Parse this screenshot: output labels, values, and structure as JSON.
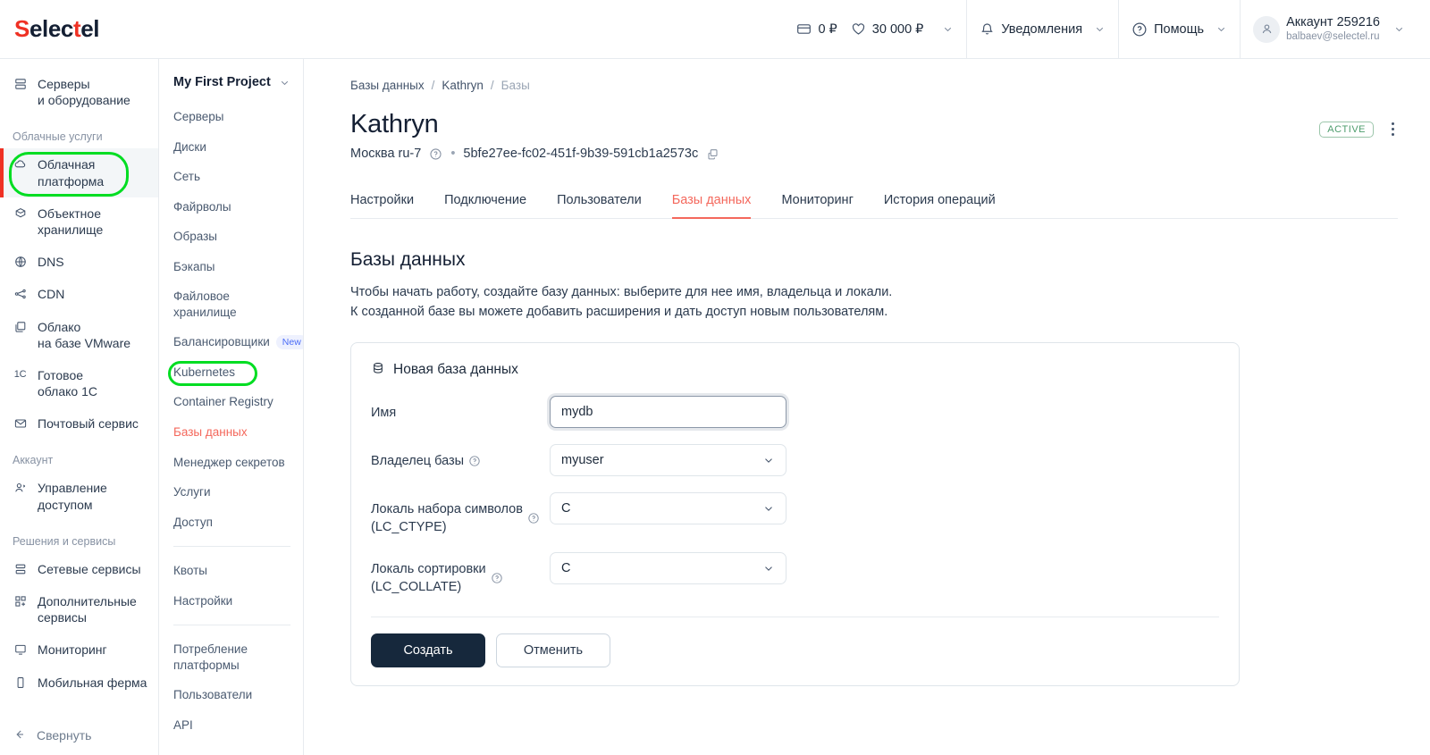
{
  "brand": {
    "name_prefix": "S",
    "name_mid": "elec",
    "name_t": "t",
    "name_suffix": "el"
  },
  "header": {
    "balance": "0 ₽",
    "bonus": "30 000 ₽",
    "notifications": "Уведомления",
    "help": "Помощь",
    "account_name": "Аккаунт 259216",
    "account_email": "balbaev@selectel.ru"
  },
  "leftnav": {
    "items": [
      {
        "label": "Серверы\nи оборудование",
        "icon": "servers-icon",
        "type": "item",
        "active": false
      },
      {
        "label": "Облачные услуги",
        "type": "section"
      },
      {
        "label": "Облачная\nплатформа",
        "icon": "cloud-icon",
        "type": "item",
        "active": true
      },
      {
        "label": "Объектное\nхранилище",
        "icon": "box-icon",
        "type": "item",
        "active": false
      },
      {
        "label": "DNS",
        "icon": "globe-icon",
        "type": "item",
        "active": false
      },
      {
        "label": "CDN",
        "icon": "cdn-icon",
        "type": "item",
        "active": false
      },
      {
        "label": "Облако\nна базе VMware",
        "icon": "vmware-icon",
        "type": "item",
        "active": false
      },
      {
        "label": "Готовое\nоблако 1С",
        "icon": "1c-icon",
        "type": "item",
        "active": false
      },
      {
        "label": "Почтовый сервис",
        "icon": "mail-icon",
        "type": "item",
        "active": false
      },
      {
        "label": "Аккаунт",
        "type": "section"
      },
      {
        "label": "Управление\nдоступом",
        "icon": "users-icon",
        "type": "item",
        "active": false
      },
      {
        "label": "Решения и сервисы",
        "type": "section"
      },
      {
        "label": "Сетевые сервисы",
        "icon": "network-icon",
        "type": "item",
        "active": false
      },
      {
        "label": "Дополнительные\nсервисы",
        "icon": "apps-icon",
        "type": "item",
        "active": false
      },
      {
        "label": "Мониторинг",
        "icon": "monitor-icon",
        "type": "item",
        "active": false
      },
      {
        "label": "Мобильная ферма",
        "icon": "mobile-icon",
        "type": "item",
        "active": false
      }
    ],
    "collapse_label": "Свернуть"
  },
  "projnav": {
    "project": "My First Project",
    "groups": [
      [
        {
          "label": "Серверы"
        },
        {
          "label": "Диски"
        },
        {
          "label": "Сеть"
        },
        {
          "label": "Файрволы"
        },
        {
          "label": "Образы"
        },
        {
          "label": "Бэкапы"
        },
        {
          "label": "Файловое хранилище"
        },
        {
          "label": "Балансировщики",
          "badge": "New"
        },
        {
          "label": "Kubernetes"
        },
        {
          "label": "Container Registry"
        },
        {
          "label": "Базы данных",
          "active": true
        },
        {
          "label": "Менеджер секретов"
        },
        {
          "label": "Услуги"
        },
        {
          "label": "Доступ"
        }
      ],
      [
        {
          "label": "Квоты"
        },
        {
          "label": "Настройки"
        }
      ],
      [
        {
          "label": "Потребление\nплатформы"
        },
        {
          "label": "Пользователи"
        },
        {
          "label": "API"
        }
      ]
    ]
  },
  "breadcrumbs": [
    {
      "label": "Базы данных",
      "current": false
    },
    {
      "label": "Kathryn",
      "current": false
    },
    {
      "label": "Базы",
      "current": true
    }
  ],
  "page": {
    "title": "Kathryn",
    "region": "Москва ru-7",
    "uuid": "5bfe27ee-fc02-451f-9b39-591cb1a2573c",
    "status_badge": "ACTIVE"
  },
  "tabs": [
    {
      "label": "Настройки",
      "active": false
    },
    {
      "label": "Подключение",
      "active": false
    },
    {
      "label": "Пользователи",
      "active": false
    },
    {
      "label": "Базы данных",
      "active": true
    },
    {
      "label": "Мониторинг",
      "active": false
    },
    {
      "label": "История операций",
      "active": false
    }
  ],
  "section": {
    "title": "Базы данных",
    "desc_line1": "Чтобы начать работу, создайте базу данных: выберите для нее имя, владельца и локали.",
    "desc_line2": "К созданной базе вы можете добавить расширения и дать доступ новым пользователям."
  },
  "form": {
    "card_title": "Новая база данных",
    "name_label": "Имя",
    "name_value": "mydb",
    "name_placeholder": "",
    "owner_label": "Владелец базы",
    "owner_value": "myuser",
    "ctype_label": "Локаль набора символов\n(LC_CTYPE)",
    "ctype_value": "C",
    "collate_label": "Локаль сортировки\n(LC_COLLATE)",
    "collate_value": "C",
    "submit_label": "Создать",
    "cancel_label": "Отменить"
  },
  "colors": {
    "brand_red": "#ef3124",
    "accent_red": "#f4685c",
    "primary_btn": "#16283c",
    "badge_green": "#4e9d6d",
    "annotation_green": "#00dd22"
  }
}
